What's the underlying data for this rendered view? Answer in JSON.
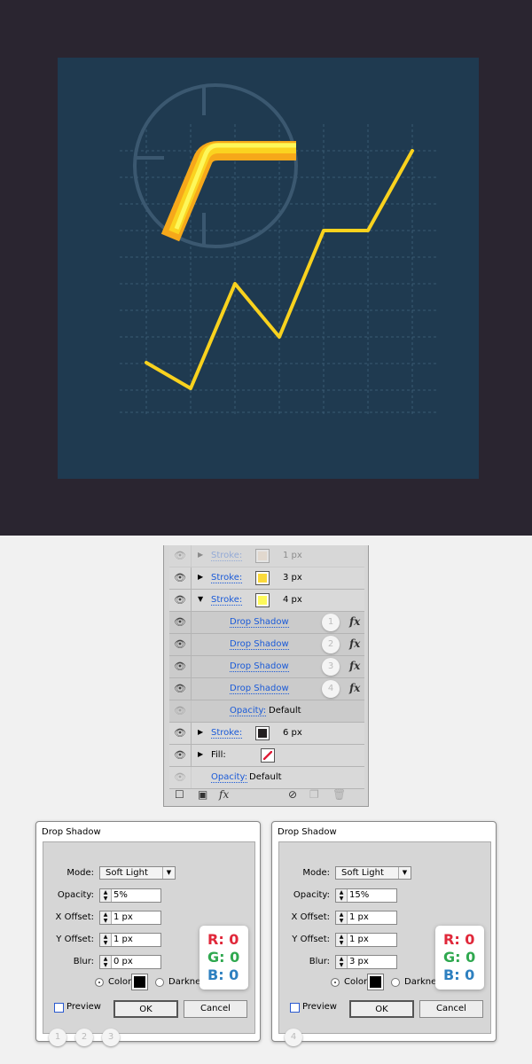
{
  "colors": {
    "frame": "#2a2530",
    "canvas": "#1f3a50",
    "line": "#f9d21e",
    "grid": "#3a5a72",
    "link": "#1a5ad8"
  },
  "panel": {
    "rows": [
      {
        "type": "stroke",
        "label": "Stroke:",
        "value": "1 px",
        "swatch": "#f7dcc0",
        "faded": true
      },
      {
        "type": "stroke",
        "label": "Stroke:",
        "value": "3 px",
        "swatch": "#fbd93a"
      },
      {
        "type": "stroke",
        "label": "Stroke:",
        "value": "4 px",
        "swatch": "#fdf95a",
        "expanded": true
      },
      {
        "type": "effect",
        "label": "Drop Shadow",
        "num": "1"
      },
      {
        "type": "effect",
        "label": "Drop Shadow",
        "num": "2"
      },
      {
        "type": "effect",
        "label": "Drop Shadow",
        "num": "3"
      },
      {
        "type": "effect",
        "label": "Drop Shadow",
        "num": "4"
      },
      {
        "type": "opacity",
        "label": "Opacity:",
        "value": "Default",
        "indent": true
      },
      {
        "type": "stroke",
        "label": "Stroke:",
        "value": "6 px",
        "swatch": "#231f20"
      },
      {
        "type": "fill",
        "label": "Fill:",
        "swatch": "none"
      },
      {
        "type": "opacity",
        "label": "Opacity:",
        "value": "Default"
      }
    ],
    "footer_fx": "fx"
  },
  "dialogs": [
    {
      "title": "Drop Shadow",
      "mode_label": "Mode:",
      "mode": "Soft Light",
      "opacity_label": "Opacity:",
      "opacity": "5%",
      "x_label": "X Offset:",
      "x": "1 px",
      "y_label": "Y Offset:",
      "y": "1 px",
      "blur_label": "Blur:",
      "blur": "0 px",
      "color_label": "Color:",
      "darkness_label": "Darknes",
      "preview": "Preview",
      "ok": "OK",
      "cancel": "Cancel",
      "r": "R: 0",
      "g": "G: 0",
      "b": "B: 0",
      "steps": [
        "1",
        "2",
        "3"
      ]
    },
    {
      "title": "Drop Shadow",
      "mode_label": "Mode:",
      "mode": "Soft Light",
      "opacity_label": "Opacity:",
      "opacity": "15%",
      "x_label": "X Offset:",
      "x": "1 px",
      "y_label": "Y Offset:",
      "y": "1 px",
      "blur_label": "Blur:",
      "blur": "3 px",
      "color_label": "Color:",
      "darkness_label": "Darkne",
      "preview": "Preview",
      "ok": "OK",
      "cancel": "Cancel",
      "r": "R: 0",
      "g": "G: 0",
      "b": "B: 0",
      "steps": [
        "4"
      ]
    }
  ]
}
